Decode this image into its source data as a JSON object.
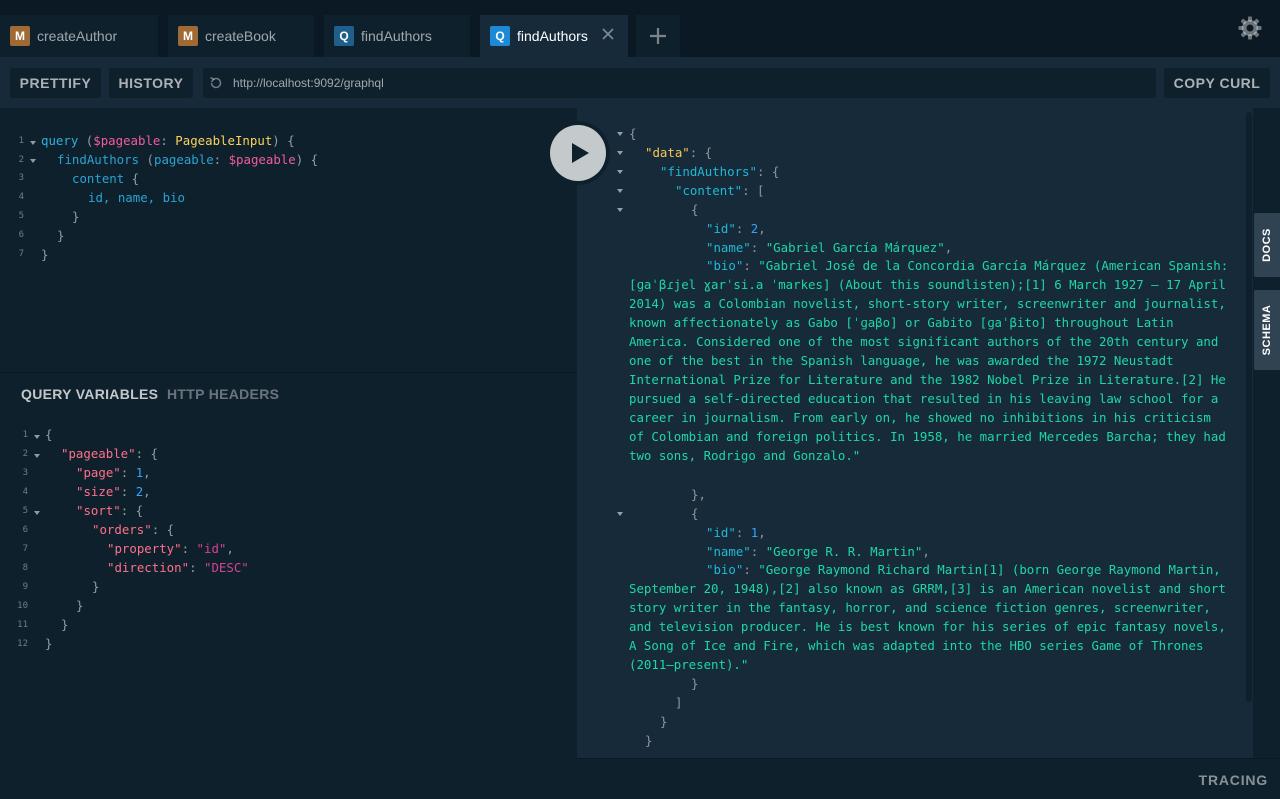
{
  "tabs": [
    {
      "badge": "M",
      "label": "createAuthor",
      "badge_color": "#a06a35"
    },
    {
      "badge": "M",
      "label": "createBook",
      "badge_color": "#a06a35"
    },
    {
      "badge": "Q",
      "label": "findAuthors",
      "badge_color": "#1f5f8b"
    },
    {
      "badge": "Q",
      "label": "findAuthors",
      "badge_color": "#1c8ad6",
      "active": true
    }
  ],
  "toolbar": {
    "prettify": "PRETTIFY",
    "history": "HISTORY",
    "endpoint": "http://localhost:9092/graphql",
    "copy_curl": "COPY CURL"
  },
  "query_lines": [
    "1",
    "2",
    "3",
    "4",
    "5",
    "6",
    "7"
  ],
  "query": {
    "kw_query": "query",
    "var_pageable": "$pageable",
    "type": "PageableInput",
    "field_find": "findAuthors",
    "arg": "pageable",
    "arg_var": "$pageable",
    "field_content": "content",
    "fields": "id, name, bio"
  },
  "variables_header": {
    "query_variables": "QUERY VARIABLES",
    "http_headers": "HTTP HEADERS"
  },
  "var_lines": [
    "1",
    "2",
    "3",
    "4",
    "5",
    "6",
    "7",
    "8",
    "9",
    "10",
    "11",
    "12"
  ],
  "variables": {
    "k_pageable": "\"pageable\"",
    "k_page": "\"page\"",
    "v_page": "1",
    "k_size": "\"size\"",
    "v_size": "2",
    "k_sort": "\"sort\"",
    "k_orders": "\"orders\"",
    "k_property": "\"property\"",
    "v_property": "\"id\"",
    "k_direction": "\"direction\"",
    "v_direction": "\"DESC\""
  },
  "result": {
    "k_data": "\"data\"",
    "k_find": "\"findAuthors\"",
    "k_content": "\"content\"",
    "k_id": "\"id\"",
    "k_name": "\"name\"",
    "k_bio": "\"bio\"",
    "authors": [
      {
        "id": "2",
        "name": "\"Gabriel García Márquez\"",
        "bio": "\"Gabriel José de la Concordia García Márquez (American Spanish: [ɡaˈβɾjel ɣarˈsi.a ˈmarkes] (About this soundlisten);[1] 6 March 1927 – 17 April 2014) was a Colombian novelist, short-story writer, screenwriter and journalist, known affectionately as Gabo [ˈɡaβo] or Gabito [ɡaˈβito] throughout Latin America. Considered one of the most significant authors of the 20th century and one of the best in the Spanish language, he was awarded the 1972 Neustadt International Prize for Literature and the 1982 Nobel Prize in Literature.[2] He pursued a self-directed education that resulted in his leaving law school for a career in journalism. From early on, he showed no inhibitions in his criticism of Colombian and foreign politics. In 1958, he married Mercedes Barcha; they had two sons, Rodrigo and Gonzalo.\""
      },
      {
        "id": "1",
        "name": "\"George R. R. Martin\"",
        "bio": "\"George Raymond Richard Martin[1] (born George Raymond Martin, September 20, 1948),[2] also known as GRRM,[3] is an American novelist and short story writer in the fantasy, horror, and science fiction genres, screenwriter, and television producer. He is best known for his series of epic fantasy novels, A Song of Ice and Fire, which was adapted into the HBO series Game of Thrones (2011–present).\""
      }
    ]
  },
  "side_tabs": {
    "docs": "DOCS",
    "schema": "SCHEMA"
  },
  "footer": {
    "tracing": "TRACING"
  },
  "icons": {
    "settings": "gear-icon",
    "play": "play-icon",
    "add_tab": "plus-icon",
    "close_tab": "close-icon",
    "reload": "reload-icon"
  }
}
